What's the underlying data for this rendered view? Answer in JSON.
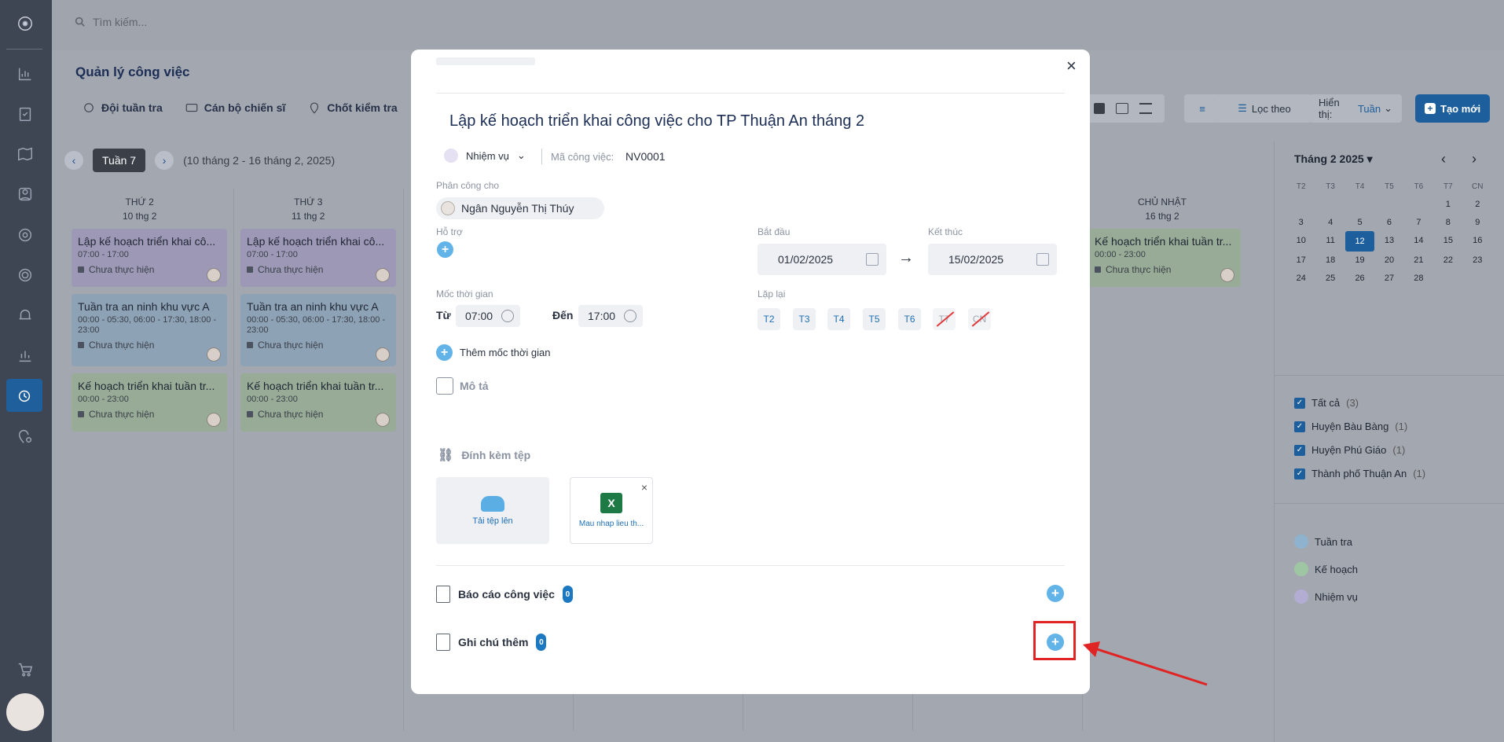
{
  "search": {
    "placeholder": "Tìm kiếm..."
  },
  "page": {
    "title": "Quản lý công việc"
  },
  "tabs": [
    {
      "label": "Đội tuần tra"
    },
    {
      "label": "Cán bộ chiến sĩ"
    },
    {
      "label": "Chốt kiểm tra"
    }
  ],
  "toolbar": {
    "filter_label": "Lọc theo",
    "display_label": "Hiển thị:",
    "display_value": "Tuần",
    "create_label": "Tạo mới"
  },
  "week": {
    "badge": "Tuần 7",
    "range": "(10 tháng 2 - 16 tháng 2, 2025)"
  },
  "columns": [
    {
      "day": "THỨ 2",
      "date": "10 thg 2"
    },
    {
      "day": "THỨ 3",
      "date": "11 thg 2"
    },
    {
      "day": "CHỦ NHẬT",
      "date": "16 thg 2"
    }
  ],
  "cards": {
    "c1": {
      "title": "Lập kế hoạch triển khai cô...",
      "time": "07:00 - 17:00",
      "status": "Chưa thực hiện"
    },
    "c2": {
      "title": "Tuần tra an ninh khu vực A",
      "time": "00:00 - 05:30, 06:00 - 17:30, 18:00 - 23:00",
      "status": "Chưa thực hiện"
    },
    "c3": {
      "title": "Kế hoạch triển khai tuần tr...",
      "time": "00:00 - 23:00",
      "status": "Chưa thực hiện"
    },
    "c4": {
      "title": "Lập kế hoạch triển khai cô...",
      "time": "07:00 - 17:00",
      "status": "Chưa thực hiện"
    },
    "c5": {
      "title": "Tuần tra an ninh khu vực A",
      "time": "00:00 - 05:30, 06:00 - 17:30, 18:00 - 23:00",
      "status": "Chưa thực hiện"
    },
    "c6": {
      "title": "Kế hoạch triển khai tuần tr...",
      "time": "00:00 - 23:00",
      "status": "Chưa thực hiện"
    },
    "c7": {
      "title": "Kế hoạch triển khai tuần tr...",
      "time": "00:00 - 23:00",
      "status": "Chưa thực hiện"
    }
  },
  "calendar": {
    "title": "Tháng 2 2025",
    "headers": [
      "T2",
      "T3",
      "T4",
      "T5",
      "T6",
      "T7",
      "CN"
    ],
    "days": [
      "",
      "",
      "",
      "",
      "",
      "1",
      "2",
      "3",
      "4",
      "5",
      "6",
      "7",
      "8",
      "9",
      "10",
      "11",
      "12",
      "13",
      "14",
      "15",
      "16",
      "17",
      "18",
      "19",
      "20",
      "21",
      "22",
      "23",
      "24",
      "25",
      "26",
      "27",
      "28",
      "",
      "",
      ""
    ],
    "selected": "12"
  },
  "filters": [
    {
      "label": "Tất cả",
      "count": "(3)"
    },
    {
      "label": "Huyện Bàu Bàng",
      "count": "(1)"
    },
    {
      "label": "Huyện Phú Giáo",
      "count": "(1)"
    },
    {
      "label": "Thành phố Thuận An",
      "count": "(1)"
    }
  ],
  "legend": [
    {
      "label": "Tuần tra",
      "color": "#8fb3cf"
    },
    {
      "label": "Kế hoạch",
      "color": "#9fc6a3"
    },
    {
      "label": "Nhiệm vụ",
      "color": "#b3acd3"
    }
  ],
  "modal": {
    "title": "Lập kế hoạch triển khai công việc cho TP Thuận An tháng 2",
    "type": "Nhiệm vụ",
    "code_label": "Mã công việc:",
    "code": "NV0001",
    "assign_label": "Phân công cho",
    "assignee": "Ngân Nguyễn Thị Thúy",
    "support_label": "Hỗ trợ",
    "start_label": "Bắt đầu",
    "start": "01/02/2025",
    "end_label": "Kết thúc",
    "end": "15/02/2025",
    "milestone_label": "Mốc thời gian",
    "from_label": "Từ",
    "from": "07:00",
    "to_label": "Đến",
    "to": "17:00",
    "add_milestone": "Thêm mốc thời gian",
    "repeat_label": "Lặp lại",
    "days": [
      {
        "label": "T2"
      },
      {
        "label": "T3"
      },
      {
        "label": "T4"
      },
      {
        "label": "T5"
      },
      {
        "label": "T6"
      },
      {
        "label": "T7"
      },
      {
        "label": "CN"
      }
    ],
    "desc_label": "Mô tả",
    "attach_label": "Đính kèm tệp",
    "upload_label": "Tải tệp lên",
    "file_name": "Mau nhap lieu th...",
    "report_label": "Báo cáo công việc",
    "report_count": "0",
    "note_label": "Ghi chú thêm",
    "note_count": "0"
  },
  "colors": {
    "primary": "#1d5e9c",
    "plus": "#62b3e8",
    "annotation": "#e02424"
  }
}
